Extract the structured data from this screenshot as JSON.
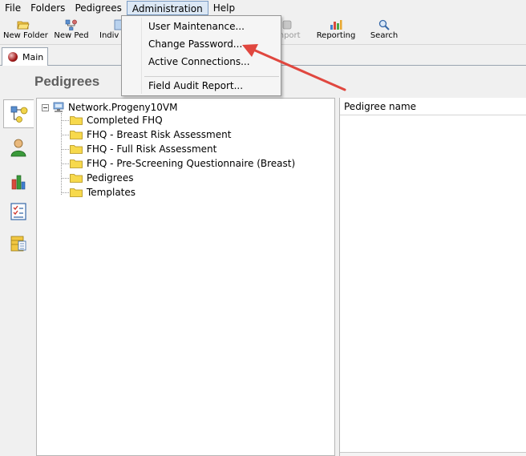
{
  "menubar": {
    "items": [
      "File",
      "Folders",
      "Pedigrees",
      "Administration",
      "Help"
    ],
    "active": "Administration"
  },
  "toolbar": {
    "new_folder": "New Folder",
    "new_ped": "New Ped",
    "indiv": "Indiv",
    "import": "Import",
    "reporting": "Reporting",
    "search": "Search"
  },
  "tabs": {
    "main": "Main"
  },
  "page": {
    "title": "Pedigrees"
  },
  "tree": {
    "root": "Network.Progeny10VM",
    "folders": [
      "Completed FHQ",
      "FHQ - Breast Risk Assessment",
      "FHQ - Full Risk Assessment",
      "FHQ - Pre-Screening Questionnaire (Breast)",
      "Pedigrees",
      "Templates"
    ]
  },
  "grid": {
    "column_header": "Pedigree name"
  },
  "admin_menu": {
    "user_maintenance": "User Maintenance...",
    "change_password": "Change Password...",
    "active_connections": "Active Connections...",
    "field_audit_report": "Field Audit Report..."
  },
  "colors": {
    "annotation_arrow": "#e0473f",
    "folder_yellow": "#f7d94c",
    "title_gray": "#5f5f5f"
  },
  "icons": {
    "tree": "tree-hierarchy-icon",
    "person": "person-icon",
    "chart": "chart-icon",
    "checklist": "checklist-icon",
    "database": "database-icon"
  }
}
